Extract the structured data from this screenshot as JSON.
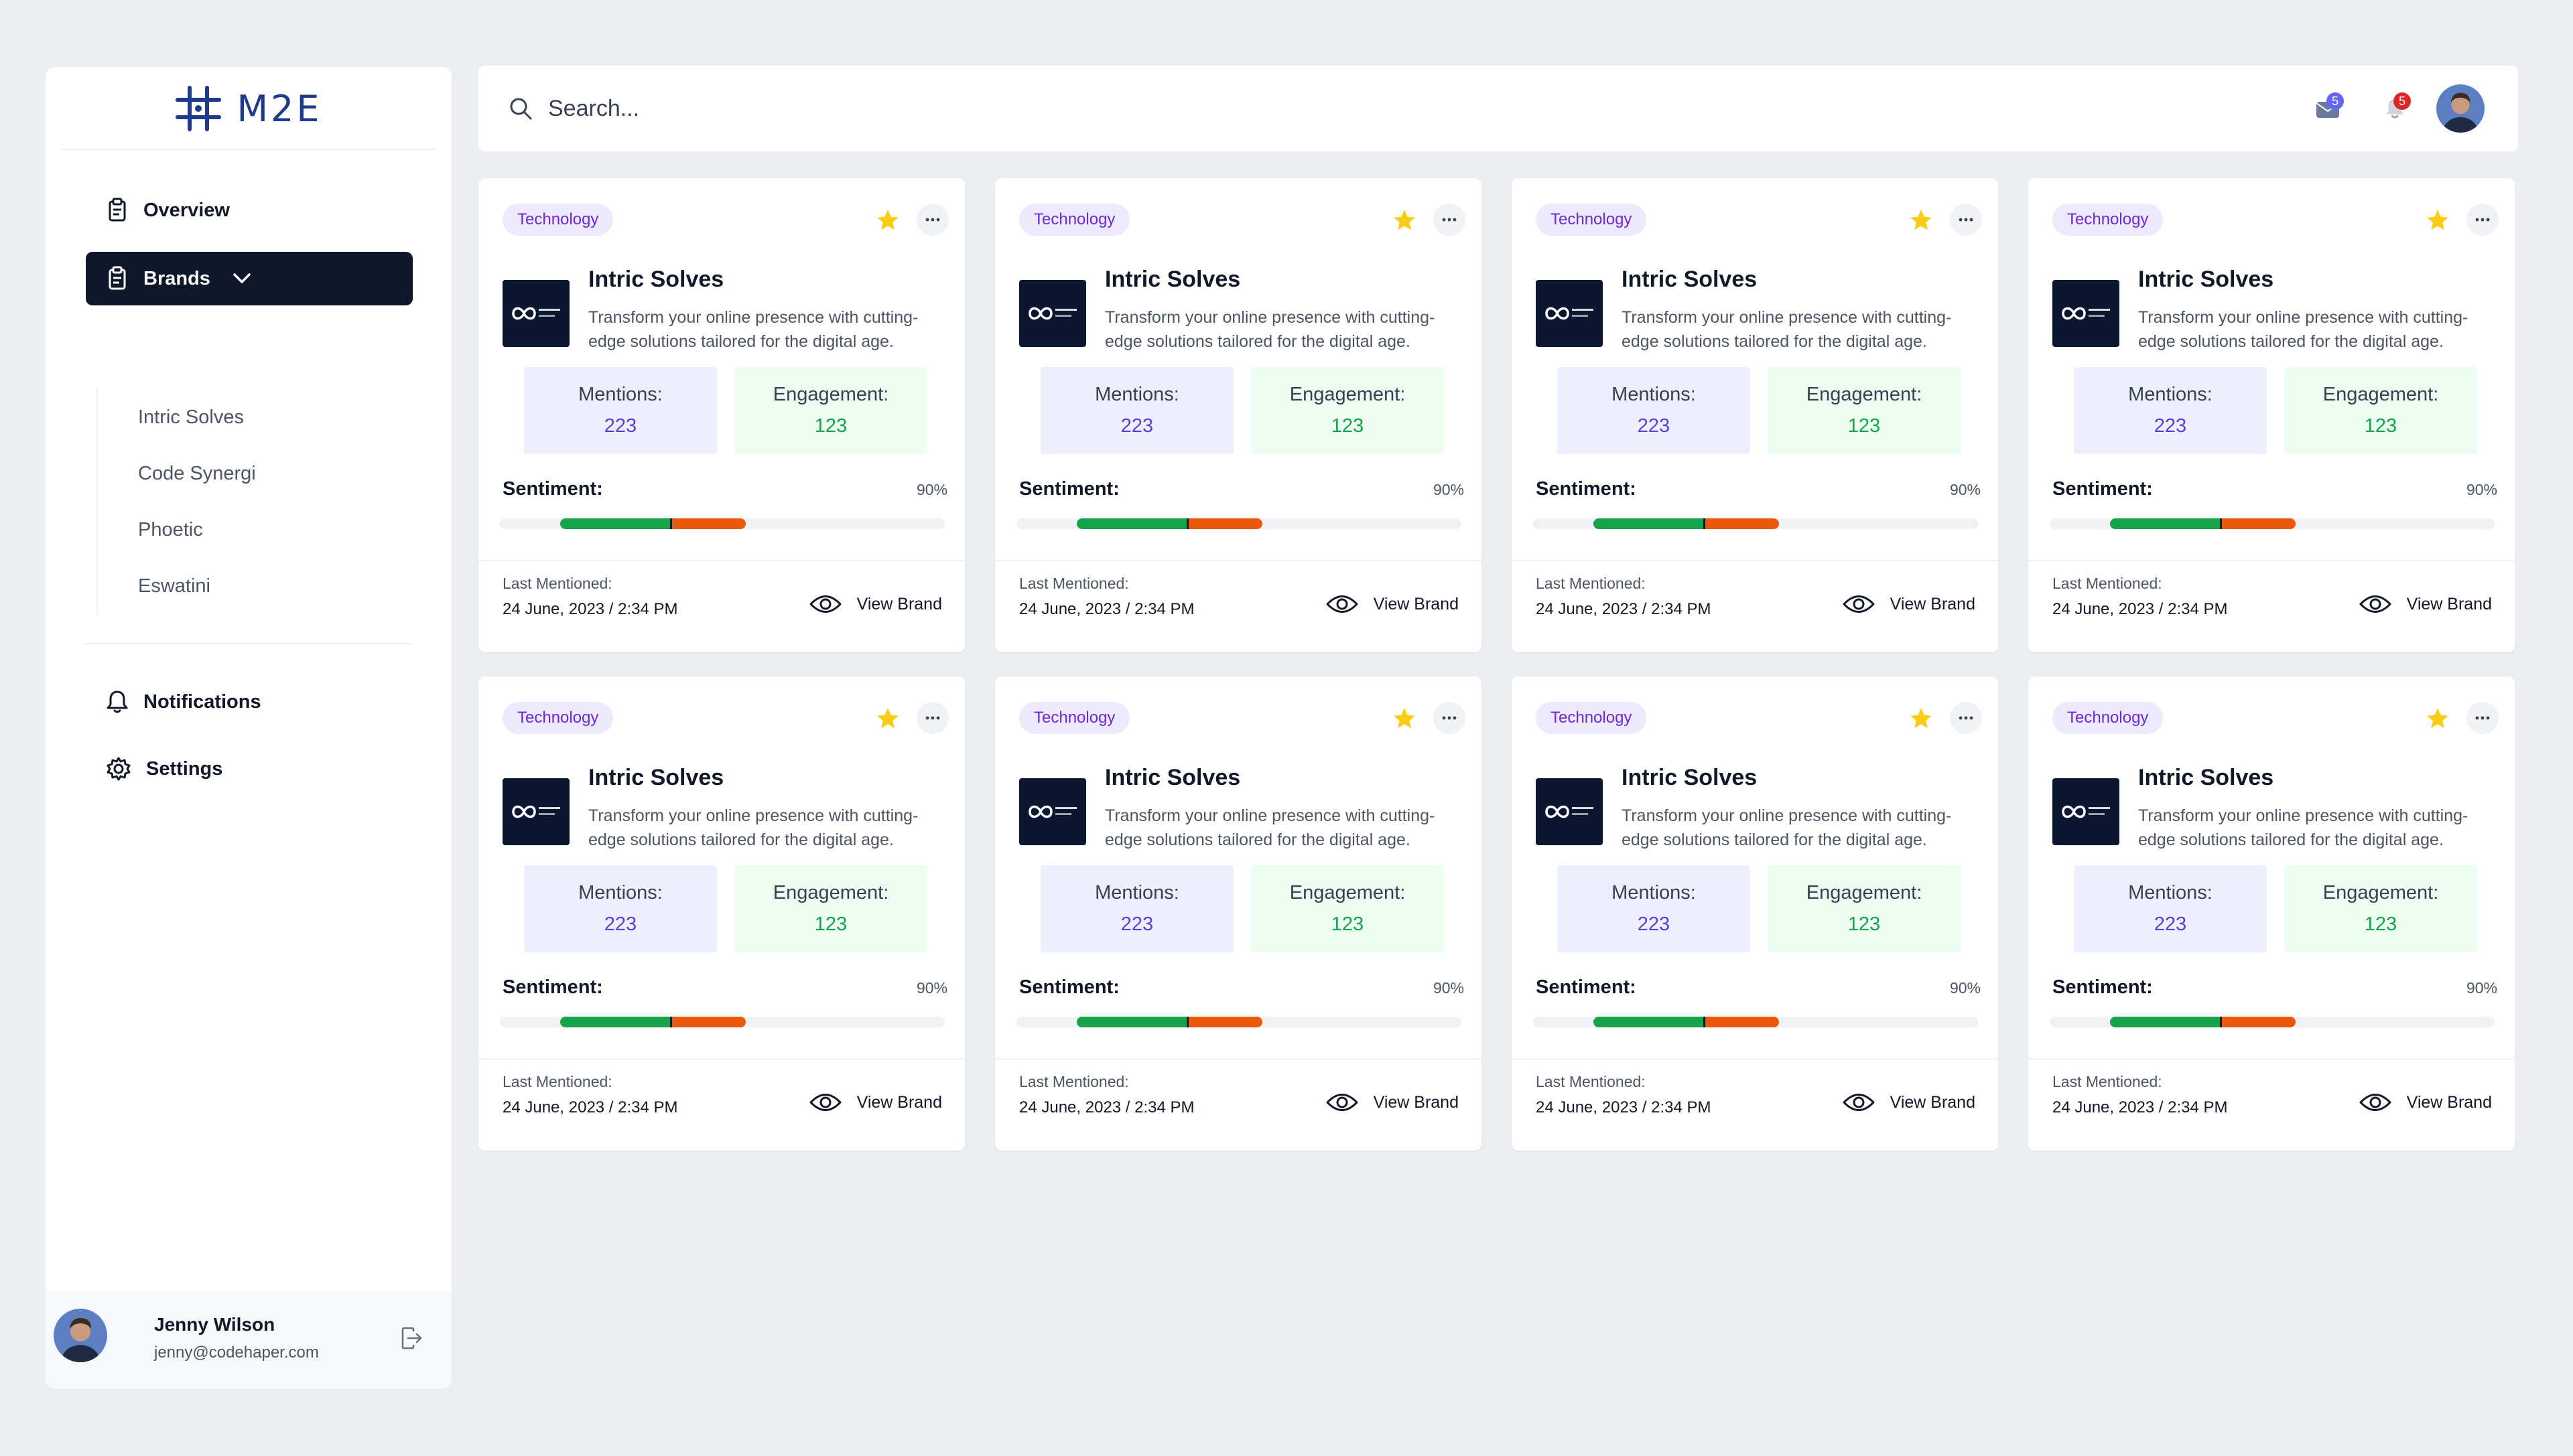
{
  "app": {
    "logo_text": "M2E",
    "brand_color": "#1e3a8a"
  },
  "sidebar": {
    "nav": [
      {
        "label": "Overview",
        "icon": "clipboard-icon",
        "active": false
      },
      {
        "label": "Brands",
        "icon": "clipboard-icon",
        "active": true,
        "expanded": true
      }
    ],
    "brands": [
      "Intric Solves",
      "Code Synergi",
      "Phoetic",
      "Eswatini"
    ],
    "secondary": [
      {
        "label": "Notifications",
        "icon": "bell-icon"
      },
      {
        "label": "Settings",
        "icon": "gear-icon"
      }
    ]
  },
  "user": {
    "name": "Jenny Wilson",
    "email": "jenny@codehaper.com"
  },
  "header": {
    "search_placeholder": "Search...",
    "messages_count": "5",
    "notifications_count": "5"
  },
  "cards": [
    {
      "tag": "Technology",
      "name": "Intric Solves",
      "description": "Transform your online presence with cutting-edge solutions tailored for the digital age.",
      "mentions_label": "Mentions:",
      "mentions": "223",
      "engagement_label": "Engagement:",
      "engagement": "123",
      "sentiment_label": "Sentiment:",
      "sentiment_percent": "90%",
      "sentiment_positive": 0.52,
      "sentiment_negative": 0.35,
      "last_label": "Last Mentioned:",
      "last_mentioned": "24 June, 2023 / 2:34 PM",
      "view_label": "View Brand",
      "favorite": true
    },
    {
      "tag": "Technology",
      "name": "Intric Solves",
      "description": "Transform your online presence with cutting-edge solutions tailored for the digital age.",
      "mentions_label": "Mentions:",
      "mentions": "223",
      "engagement_label": "Engagement:",
      "engagement": "123",
      "sentiment_label": "Sentiment:",
      "sentiment_percent": "90%",
      "sentiment_positive": 0.52,
      "sentiment_negative": 0.35,
      "last_label": "Last Mentioned:",
      "last_mentioned": "24 June, 2023 / 2:34 PM",
      "view_label": "View Brand",
      "favorite": true
    },
    {
      "tag": "Technology",
      "name": "Intric Solves",
      "description": "Transform your online presence with cutting-edge solutions tailored for the digital age.",
      "mentions_label": "Mentions:",
      "mentions": "223",
      "engagement_label": "Engagement:",
      "engagement": "123",
      "sentiment_label": "Sentiment:",
      "sentiment_percent": "90%",
      "sentiment_positive": 0.52,
      "sentiment_negative": 0.35,
      "last_label": "Last Mentioned:",
      "last_mentioned": "24 June, 2023 / 2:34 PM",
      "view_label": "View Brand",
      "favorite": true
    },
    {
      "tag": "Technology",
      "name": "Intric Solves",
      "description": "Transform your online presence with cutting-edge solutions tailored for the digital age.",
      "mentions_label": "Mentions:",
      "mentions": "223",
      "engagement_label": "Engagement:",
      "engagement": "123",
      "sentiment_label": "Sentiment:",
      "sentiment_percent": "90%",
      "sentiment_positive": 0.52,
      "sentiment_negative": 0.35,
      "last_label": "Last Mentioned:",
      "last_mentioned": "24 June, 2023 / 2:34 PM",
      "view_label": "View Brand",
      "favorite": true
    },
    {
      "tag": "Technology",
      "name": "Intric Solves",
      "description": "Transform your online presence with cutting-edge solutions tailored for the digital age.",
      "mentions_label": "Mentions:",
      "mentions": "223",
      "engagement_label": "Engagement:",
      "engagement": "123",
      "sentiment_label": "Sentiment:",
      "sentiment_percent": "90%",
      "sentiment_positive": 0.52,
      "sentiment_negative": 0.35,
      "last_label": "Last Mentioned:",
      "last_mentioned": "24 June, 2023 / 2:34 PM",
      "view_label": "View Brand",
      "favorite": true
    },
    {
      "tag": "Technology",
      "name": "Intric Solves",
      "description": "Transform your online presence with cutting-edge solutions tailored for the digital age.",
      "mentions_label": "Mentions:",
      "mentions": "223",
      "engagement_label": "Engagement:",
      "engagement": "123",
      "sentiment_label": "Sentiment:",
      "sentiment_percent": "90%",
      "sentiment_positive": 0.52,
      "sentiment_negative": 0.35,
      "last_label": "Last Mentioned:",
      "last_mentioned": "24 June, 2023 / 2:34 PM",
      "view_label": "View Brand",
      "favorite": true
    },
    {
      "tag": "Technology",
      "name": "Intric Solves",
      "description": "Transform your online presence with cutting-edge solutions tailored for the digital age.",
      "mentions_label": "Mentions:",
      "mentions": "223",
      "engagement_label": "Engagement:",
      "engagement": "123",
      "sentiment_label": "Sentiment:",
      "sentiment_percent": "90%",
      "sentiment_positive": 0.52,
      "sentiment_negative": 0.35,
      "last_label": "Last Mentioned:",
      "last_mentioned": "24 June, 2023 / 2:34 PM",
      "view_label": "View Brand",
      "favorite": true
    },
    {
      "tag": "Technology",
      "name": "Intric Solves",
      "description": "Transform your online presence with cutting-edge solutions tailored for the digital age.",
      "mentions_label": "Mentions:",
      "mentions": "223",
      "engagement_label": "Engagement:",
      "engagement": "123",
      "sentiment_label": "Sentiment:",
      "sentiment_percent": "90%",
      "sentiment_positive": 0.52,
      "sentiment_negative": 0.35,
      "last_label": "Last Mentioned:",
      "last_mentioned": "24 June, 2023 / 2:34 PM",
      "view_label": "View Brand",
      "favorite": true
    }
  ],
  "colors": {
    "tag_bg": "#ede9fe",
    "tag_text": "#6d28d9",
    "positive": "#16a34a",
    "negative": "#ea580c",
    "star": "#facc15",
    "active_nav": "#0f172a"
  }
}
